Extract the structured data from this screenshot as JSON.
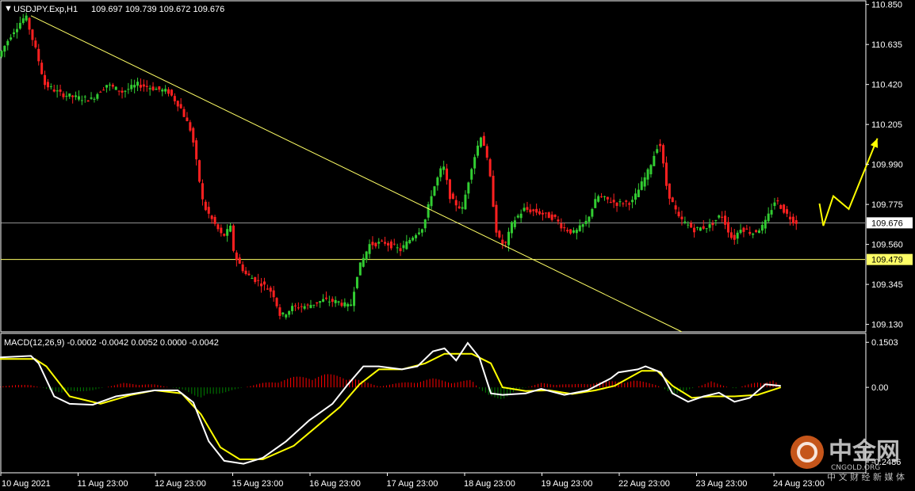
{
  "chart_data": {
    "type": "candlestick",
    "price_panel": {
      "header": {
        "symbol_line": "USDJPY.Exp,H1",
        "ohlc": "109.697 109.739 109.672 109.676"
      },
      "y_ticks": [
        "110.850",
        "110.635",
        "110.420",
        "110.205",
        "109.990",
        "109.775",
        "109.560",
        "109.345",
        "109.130"
      ],
      "ylim": [
        109.09,
        110.87
      ],
      "current_price": {
        "label": "109.676",
        "value": 109.676
      },
      "support_line": {
        "label": "109.479",
        "value": 109.479
      },
      "trendline": {
        "from": [
          0.4,
          110.79
        ],
        "to": [
          8.82,
          109.09
        ]
      },
      "forecast_path": [
        [
          10.6,
          109.78
        ],
        [
          10.65,
          109.66
        ],
        [
          10.78,
          109.82
        ],
        [
          10.98,
          109.75
        ],
        [
          11.35,
          110.13
        ]
      ],
      "path": [
        [
          0.0,
          110.57
        ],
        [
          0.18,
          110.7
        ],
        [
          0.35,
          110.79
        ],
        [
          0.5,
          110.58
        ],
        [
          0.6,
          110.42
        ],
        [
          0.8,
          110.37
        ],
        [
          1.0,
          110.35
        ],
        [
          1.2,
          110.34
        ],
        [
          1.4,
          110.42
        ],
        [
          1.6,
          110.38
        ],
        [
          1.8,
          110.42
        ],
        [
          2.0,
          110.4
        ],
        [
          2.2,
          110.38
        ],
        [
          2.35,
          110.3
        ],
        [
          2.5,
          110.16
        ],
        [
          2.65,
          109.77
        ],
        [
          2.78,
          109.68
        ],
        [
          2.9,
          109.6
        ],
        [
          3.0,
          109.65
        ],
        [
          3.05,
          109.5
        ],
        [
          3.2,
          109.4
        ],
        [
          3.4,
          109.35
        ],
        [
          3.55,
          109.3
        ],
        [
          3.65,
          109.17
        ],
        [
          3.8,
          109.22
        ],
        [
          4.0,
          109.23
        ],
        [
          4.2,
          109.26
        ],
        [
          4.4,
          109.25
        ],
        [
          4.55,
          109.22
        ],
        [
          4.65,
          109.42
        ],
        [
          4.8,
          109.56
        ],
        [
          5.0,
          109.57
        ],
        [
          5.2,
          109.53
        ],
        [
          5.35,
          109.6
        ],
        [
          5.5,
          109.66
        ],
        [
          5.6,
          109.83
        ],
        [
          5.75,
          109.99
        ],
        [
          5.85,
          109.8
        ],
        [
          6.0,
          109.75
        ],
        [
          6.12,
          109.98
        ],
        [
          6.25,
          110.16
        ],
        [
          6.35,
          109.95
        ],
        [
          6.45,
          109.6
        ],
        [
          6.55,
          109.55
        ],
        [
          6.65,
          109.68
        ],
        [
          6.8,
          109.75
        ],
        [
          7.0,
          109.73
        ],
        [
          7.2,
          109.7
        ],
        [
          7.3,
          109.65
        ],
        [
          7.45,
          109.62
        ],
        [
          7.6,
          109.68
        ],
        [
          7.75,
          109.82
        ],
        [
          8.0,
          109.78
        ],
        [
          8.2,
          109.79
        ],
        [
          8.4,
          109.95
        ],
        [
          8.55,
          110.12
        ],
        [
          8.65,
          109.85
        ],
        [
          8.8,
          109.7
        ],
        [
          9.0,
          109.64
        ],
        [
          9.2,
          109.66
        ],
        [
          9.35,
          109.72
        ],
        [
          9.5,
          109.58
        ],
        [
          9.6,
          109.65
        ],
        [
          9.75,
          109.62
        ],
        [
          9.9,
          109.66
        ],
        [
          10.05,
          109.8
        ],
        [
          10.2,
          109.72
        ],
        [
          10.3,
          109.68
        ]
      ]
    },
    "macd_panel": {
      "header": "MACD(12,26,9) -0.0002 -0.0042 0.0052 0.0000 -0.0042",
      "y_ticks": [
        "0.1503",
        "0.00",
        "-0.2486"
      ],
      "ylim": [
        -0.285,
        0.18
      ],
      "macd_line": [
        [
          0.0,
          0.1
        ],
        [
          0.4,
          0.105
        ],
        [
          0.5,
          0.08
        ],
        [
          0.7,
          -0.03
        ],
        [
          0.9,
          -0.055
        ],
        [
          1.2,
          -0.058
        ],
        [
          1.5,
          -0.03
        ],
        [
          2.0,
          -0.01
        ],
        [
          2.3,
          -0.01
        ],
        [
          2.5,
          -0.05
        ],
        [
          2.7,
          -0.18
        ],
        [
          2.9,
          -0.245
        ],
        [
          3.15,
          -0.255
        ],
        [
          3.4,
          -0.235
        ],
        [
          3.7,
          -0.18
        ],
        [
          4.0,
          -0.11
        ],
        [
          4.3,
          -0.055
        ],
        [
          4.5,
          0.01
        ],
        [
          4.7,
          0.07
        ],
        [
          4.9,
          0.07
        ],
        [
          5.2,
          0.06
        ],
        [
          5.4,
          0.07
        ],
        [
          5.6,
          0.12
        ],
        [
          5.75,
          0.13
        ],
        [
          5.9,
          0.09
        ],
        [
          6.05,
          0.148
        ],
        [
          6.2,
          0.1
        ],
        [
          6.35,
          -0.02
        ],
        [
          6.5,
          -0.025
        ],
        [
          6.8,
          -0.02
        ],
        [
          7.0,
          -0.005
        ],
        [
          7.3,
          -0.025
        ],
        [
          7.6,
          -0.01
        ],
        [
          7.9,
          0.03
        ],
        [
          8.0,
          0.05
        ],
        [
          8.25,
          0.06
        ],
        [
          8.35,
          0.07
        ],
        [
          8.55,
          0.05
        ],
        [
          8.7,
          -0.02
        ],
        [
          8.9,
          -0.048
        ],
        [
          9.1,
          -0.03
        ],
        [
          9.3,
          -0.018
        ],
        [
          9.5,
          -0.048
        ],
        [
          9.7,
          -0.035
        ],
        [
          9.9,
          0.01
        ],
        [
          10.1,
          0.005
        ]
      ],
      "signal_line": [
        [
          0.0,
          0.095
        ],
        [
          0.45,
          0.095
        ],
        [
          0.6,
          0.07
        ],
        [
          0.9,
          -0.03
        ],
        [
          1.3,
          -0.055
        ],
        [
          1.7,
          -0.025
        ],
        [
          2.0,
          -0.01
        ],
        [
          2.35,
          -0.02
        ],
        [
          2.6,
          -0.09
        ],
        [
          2.85,
          -0.2
        ],
        [
          3.1,
          -0.24
        ],
        [
          3.4,
          -0.24
        ],
        [
          3.8,
          -0.195
        ],
        [
          4.1,
          -0.13
        ],
        [
          4.4,
          -0.065
        ],
        [
          4.65,
          0.01
        ],
        [
          4.9,
          0.06
        ],
        [
          5.2,
          0.06
        ],
        [
          5.5,
          0.08
        ],
        [
          5.75,
          0.112
        ],
        [
          6.1,
          0.112
        ],
        [
          6.35,
          0.08
        ],
        [
          6.5,
          0.0
        ],
        [
          6.8,
          -0.012
        ],
        [
          7.1,
          -0.01
        ],
        [
          7.4,
          -0.022
        ],
        [
          7.7,
          -0.01
        ],
        [
          7.95,
          0.005
        ],
        [
          8.3,
          0.055
        ],
        [
          8.5,
          0.055
        ],
        [
          8.7,
          0.005
        ],
        [
          8.95,
          -0.035
        ],
        [
          9.2,
          -0.03
        ],
        [
          9.5,
          -0.03
        ],
        [
          9.8,
          -0.025
        ],
        [
          10.1,
          0.0
        ]
      ],
      "histogram": [
        [
          0.0,
          0.005
        ],
        [
          0.4,
          0.01
        ],
        [
          0.8,
          -0.02
        ],
        [
          1.2,
          -0.01
        ],
        [
          1.6,
          0.015
        ],
        [
          2.0,
          0.01
        ],
        [
          2.4,
          -0.01
        ],
        [
          2.6,
          -0.04
        ],
        [
          2.8,
          -0.025
        ],
        [
          3.0,
          -0.01
        ],
        [
          3.4,
          0.015
        ],
        [
          3.8,
          0.035
        ],
        [
          4.2,
          0.045
        ],
        [
          4.5,
          0.04
        ],
        [
          4.7,
          0.02
        ],
        [
          4.9,
          0.005
        ],
        [
          5.3,
          0.02
        ],
        [
          5.6,
          0.03
        ],
        [
          5.9,
          0.02
        ],
        [
          6.1,
          0.025
        ],
        [
          6.3,
          -0.035
        ],
        [
          6.5,
          -0.04
        ],
        [
          6.7,
          -0.01
        ],
        [
          7.0,
          0.015
        ],
        [
          7.4,
          0.01
        ],
        [
          7.8,
          0.02
        ],
        [
          8.2,
          0.025
        ],
        [
          8.5,
          0.01
        ],
        [
          8.7,
          -0.025
        ],
        [
          8.9,
          -0.01
        ],
        [
          9.2,
          0.02
        ],
        [
          9.5,
          -0.005
        ],
        [
          9.8,
          0.02
        ],
        [
          10.0,
          0.025
        ],
        [
          10.1,
          0.005
        ]
      ]
    },
    "x_labels": [
      "10 Aug 2021",
      "11 Aug 23:00",
      "12 Aug 23:00",
      "15 Aug 23:00",
      "16 Aug 23:00",
      "17 Aug 23:00",
      "18 Aug 23:00",
      "19 Aug 23:00",
      "22 Aug 23:00",
      "23 Aug 23:00",
      "24 Aug 23:00"
    ],
    "colors": {
      "background": "#000000",
      "bull": "#32cd32",
      "bear": "#ff2020",
      "trendline": "#ffff66",
      "support": "#ffff66",
      "current": "#c0c0c0",
      "forecast": "#ffff00",
      "macd": "#ffffff",
      "signal": "#ffff00",
      "hist_pos": "#ff0000",
      "hist_neg": "#008000",
      "axis": "#ffffff"
    }
  },
  "watermark": {
    "title": "中金网",
    "domain": "CNGOLD.ORG",
    "subtitle": "中 文 财 经 新 媒 体"
  }
}
